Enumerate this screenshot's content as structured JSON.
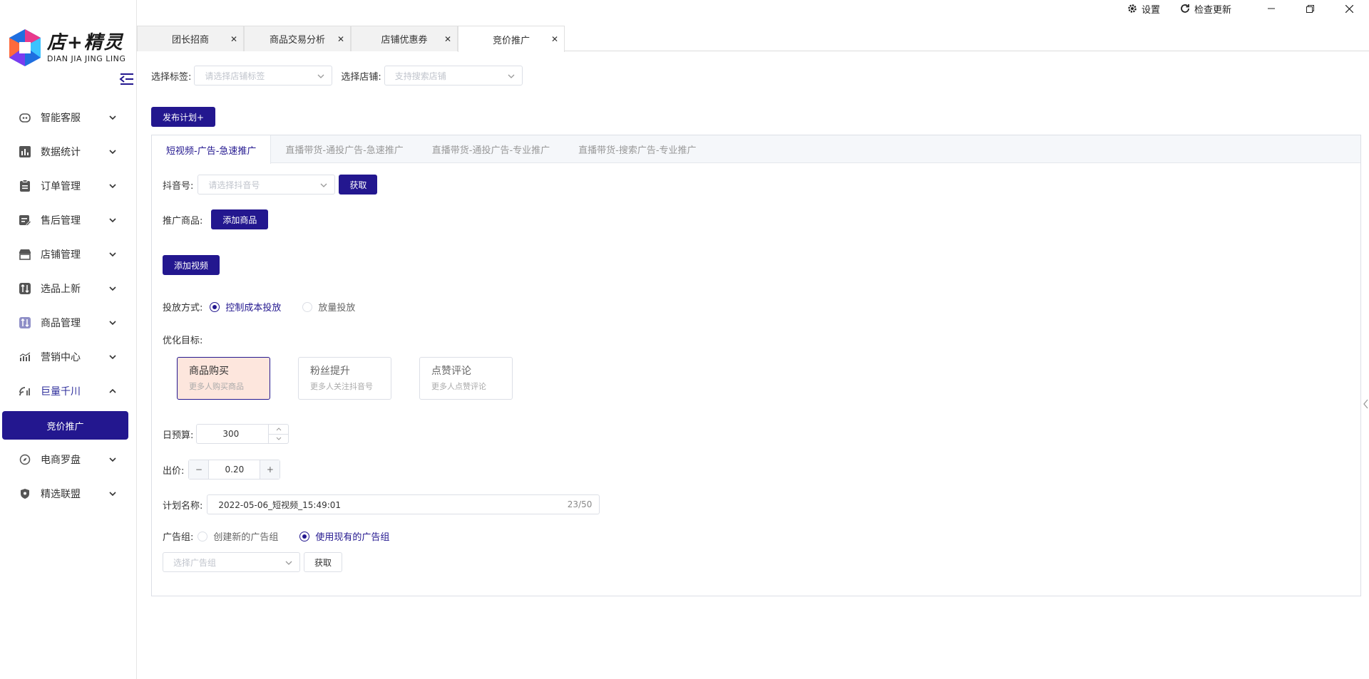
{
  "app": {
    "logo_main": "店+精灵",
    "logo_sub": "DIAN JIA JING LING"
  },
  "topbar": {
    "settings_label": "设置",
    "update_label": "检查更新"
  },
  "tabs": [
    {
      "label": "团长招商"
    },
    {
      "label": "商品交易分析"
    },
    {
      "label": "店铺优惠券"
    },
    {
      "label": "竞价推广",
      "active": true
    }
  ],
  "sidebar": {
    "items": [
      {
        "label": "智能客服",
        "icon": "robot-icon"
      },
      {
        "label": "数据统计",
        "icon": "bar-chart-icon"
      },
      {
        "label": "订单管理",
        "icon": "clipboard-icon"
      },
      {
        "label": "售后管理",
        "icon": "edit-list-icon"
      },
      {
        "label": "店铺管理",
        "icon": "store-icon"
      },
      {
        "label": "选品上新",
        "icon": "swap-icon"
      },
      {
        "label": "商品管理",
        "icon": "swap-icon"
      },
      {
        "label": "营销中心",
        "icon": "growth-chart-icon"
      },
      {
        "label": "巨量千川",
        "icon": "signal-icon",
        "open": true
      },
      {
        "label": "电商罗盘",
        "icon": "compass-icon"
      },
      {
        "label": "精选联盟",
        "icon": "shield-icon"
      }
    ],
    "subitem": "竞价推广"
  },
  "filters": {
    "tag_label": "选择标签:",
    "tag_placeholder": "请选择店铺标签",
    "shop_label": "选择店铺:",
    "shop_placeholder": "支持搜索店铺"
  },
  "publish_button": "发布计划+",
  "panel": {
    "tabs": [
      {
        "label": "短视频-广告-急速推广",
        "active": true
      },
      {
        "label": "直播带货-通投广告-急速推广"
      },
      {
        "label": "直播带货-通投广告-专业推广"
      },
      {
        "label": "直播带货-搜索广告-专业推广"
      }
    ],
    "douyin_label": "抖音号:",
    "douyin_placeholder": "请选择抖音号",
    "fetch_button": "获取",
    "product_label": "推广商品:",
    "add_product_button": "添加商品",
    "add_video_button": "添加视频",
    "delivery_label": "投放方式:",
    "delivery_options": [
      {
        "label": "控制成本投放",
        "selected": true
      },
      {
        "label": "放量投放",
        "selected": false
      }
    ],
    "goal_label": "优化目标:",
    "goals": [
      {
        "title": "商品购买",
        "desc": "更多人购买商品",
        "selected": true
      },
      {
        "title": "粉丝提升",
        "desc": "更多人关注抖音号",
        "selected": false
      },
      {
        "title": "点赞评论",
        "desc": "更多人点赞评论",
        "selected": false
      }
    ],
    "budget_label": "日预算:",
    "budget_value": "300",
    "bid_label": "出价:",
    "bid_value": "0.20",
    "plan_name_label": "计划名称:",
    "plan_name_value": "2022-05-06_短视频_15:49:01",
    "plan_name_count": "23/50",
    "adgroup_label": "广告组:",
    "adgroup_options": [
      {
        "label": "创建新的广告组",
        "selected": false
      },
      {
        "label": "使用现有的广告组",
        "selected": true
      }
    ],
    "adgroup_placeholder": "选择广告组",
    "adgroup_fetch_button": "获取"
  },
  "colors": {
    "primary": "#23178f",
    "selected_card_bg": "#fde6dd"
  }
}
